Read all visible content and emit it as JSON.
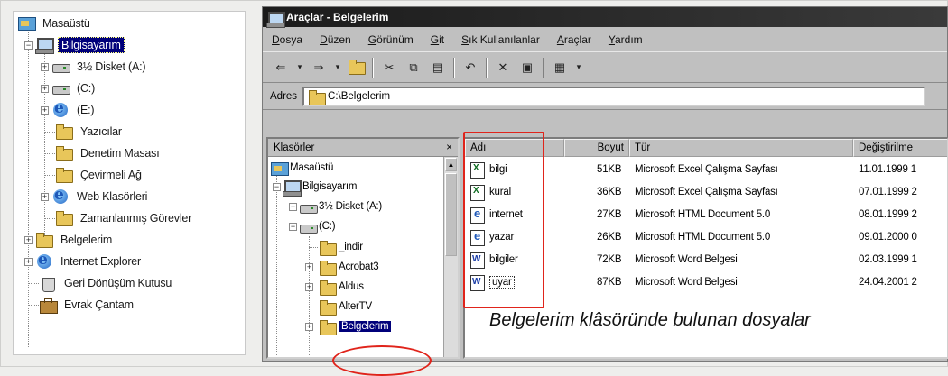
{
  "left_tree": {
    "items": [
      {
        "label": "Masaüstü",
        "icon": "desktop-icon"
      },
      {
        "label": "Bilgisayarım",
        "icon": "computer-icon",
        "selected": true
      },
      {
        "label": "3½ Disket (A:)",
        "icon": "floppy-drive-icon"
      },
      {
        "label": "(C:)",
        "icon": "hard-drive-icon"
      },
      {
        "label": "(E:)",
        "icon": "cd-drive-icon"
      },
      {
        "label": "Yazıcılar",
        "icon": "printers-folder-icon"
      },
      {
        "label": "Denetim Masası",
        "icon": "control-panel-folder-icon"
      },
      {
        "label": "Çevirmeli Ağ",
        "icon": "dial-up-folder-icon"
      },
      {
        "label": "Web Klasörleri",
        "icon": "web-folders-icon"
      },
      {
        "label": "Zamanlanmış Görevler",
        "icon": "scheduled-tasks-folder-icon"
      },
      {
        "label": "Belgelerim",
        "icon": "documents-folder-icon"
      },
      {
        "label": "Internet Explorer",
        "icon": "internet-explorer-icon"
      },
      {
        "label": "Geri Dönüşüm Kutusu",
        "icon": "recycle-bin-icon"
      },
      {
        "label": "Evrak Çantam",
        "icon": "briefcase-icon"
      }
    ]
  },
  "window": {
    "title": "Araçlar - Belgelerim",
    "menu": [
      "Dosya",
      "Düzen",
      "Görünüm",
      "Git",
      "Sık Kullanılanlar",
      "Araçlar",
      "Yardım"
    ],
    "toolbar_icons": [
      "back-icon",
      "forward-icon",
      "up-folder-icon",
      "cut-icon",
      "copy-icon",
      "paste-icon",
      "undo-icon",
      "delete-icon",
      "properties-icon",
      "views-icon"
    ],
    "address_label": "Adres",
    "address_value": "C:\\Belgelerim"
  },
  "folders_pane": {
    "title": "Klasörler",
    "close": "×",
    "items": [
      {
        "label": "Masaüstü"
      },
      {
        "label": "Bilgisayarım"
      },
      {
        "label": "3½ Disket (A:)"
      },
      {
        "label": "(C:)"
      },
      {
        "label": "_indir"
      },
      {
        "label": "Acrobat3"
      },
      {
        "label": "Aldus"
      },
      {
        "label": "AlterTV"
      },
      {
        "label": "Belgelerim",
        "selected": true
      }
    ]
  },
  "file_pane": {
    "columns": [
      "Adı",
      "Boyut",
      "Tür",
      "Değiştirilme"
    ],
    "rows": [
      {
        "name": "bilgi",
        "size": "51KB",
        "type": "Microsoft Excel Çalışma Sayfası",
        "modified": "11.01.1999 1",
        "icon": "excel-file-icon"
      },
      {
        "name": "kural",
        "size": "36KB",
        "type": "Microsoft Excel Çalışma Sayfası",
        "modified": "07.01.1999 2",
        "icon": "excel-file-icon"
      },
      {
        "name": "internet",
        "size": "27KB",
        "type": "Microsoft HTML Document 5.0",
        "modified": "08.01.1999 2",
        "icon": "html-file-icon"
      },
      {
        "name": "yazar",
        "size": "26KB",
        "type": "Microsoft HTML Document 5.0",
        "modified": "09.01.2000 0",
        "icon": "html-file-icon"
      },
      {
        "name": "bilgiler",
        "size": "72KB",
        "type": "Microsoft Word Belgesi",
        "modified": "02.03.1999 1",
        "icon": "word-file-icon"
      },
      {
        "name": "uyar",
        "size": "87KB",
        "type": "Microsoft Word Belgesi",
        "modified": "24.04.2001 2",
        "icon": "word-file-icon"
      }
    ]
  },
  "caption": "Belgelerim klâsöründe bulunan dosyalar",
  "colors": {
    "highlight": "#00007a",
    "annotation_red": "#e0241b",
    "window_face": "#c0c0c0"
  }
}
